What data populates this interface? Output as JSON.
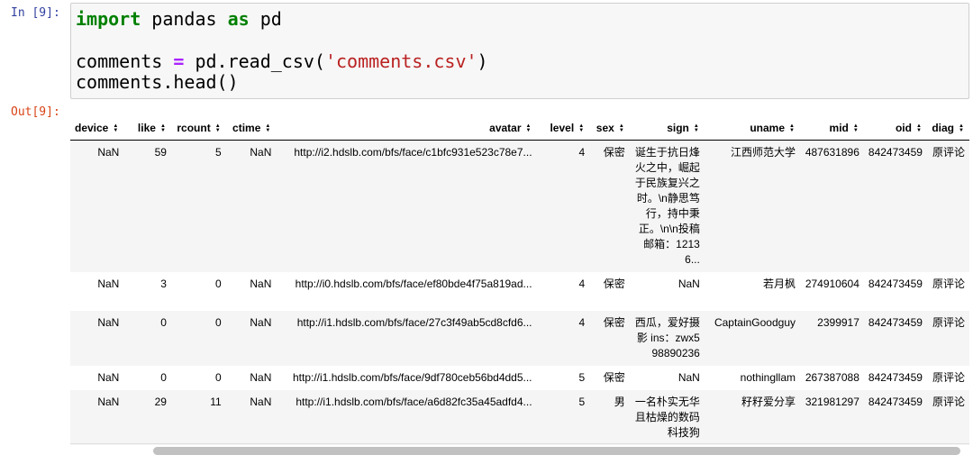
{
  "input_cell": {
    "prompt": "In [9]:",
    "line1": {
      "kw1": "import",
      "mid": " pandas ",
      "kw2": "as",
      "tail": " pd"
    },
    "line2": {
      "lhs": "comments ",
      "op": "=",
      "call": " pd.read_csv(",
      "str": "'comments.csv'",
      "close": ")"
    },
    "line3": "comments.head()"
  },
  "output_cell": {
    "prompt": "Out[9]:"
  },
  "table": {
    "columns": [
      "device",
      "like",
      "rcount",
      "ctime",
      "avatar",
      "level",
      "sex",
      "sign",
      "uname",
      "mid",
      "oid",
      "diag"
    ],
    "sort_arrow": "▲▼",
    "rows": [
      [
        "NaN",
        "59",
        "5",
        "NaN",
        "http://i2.hdslb.com/bfs/face/c1bfc931e523c78e7...",
        "4",
        "保密",
        "诞生于抗日烽火之中，崛起于民族复兴之时。\\n静思笃行，持中秉正。\\n\\n投稿邮箱：12136...",
        "江西师范大学",
        "487631896",
        "842473459",
        "原评论"
      ],
      [
        "NaN",
        "3",
        "0",
        "NaN",
        "http://i0.hdslb.com/bfs/face/ef80bde4f75a819ad...",
        "4",
        "保密",
        "NaN",
        "若月枫",
        "274910604",
        "842473459",
        "原评论"
      ],
      [
        "NaN",
        "0",
        "0",
        "NaN",
        "http://i1.hdslb.com/bfs/face/27c3f49ab5cd8cfd6...",
        "4",
        "保密",
        "西瓜，爱好摄影 ins：zwx598890236",
        "CaptainGoodguy",
        "2399917",
        "842473459",
        "原评论"
      ],
      [
        "NaN",
        "0",
        "0",
        "NaN",
        "http://i1.hdslb.com/bfs/face/9df780ceb56bd4dd5...",
        "5",
        "保密",
        "NaN",
        "nothingllam",
        "267387088",
        "842473459",
        "原评论"
      ],
      [
        "NaN",
        "29",
        "11",
        "NaN",
        "http://i1.hdslb.com/bfs/face/a6d82fc35a45adfd4...",
        "5",
        "男",
        "一名朴实无华且枯燥的数码科技狗",
        "籽籽爱分享",
        "321981297",
        "842473459",
        "原评论"
      ]
    ]
  },
  "colors": {
    "in_prompt": "#303f9f",
    "out_prompt": "#d84315",
    "keyword": "#008000",
    "operator": "#aa22ff",
    "string": "#ba2121"
  }
}
